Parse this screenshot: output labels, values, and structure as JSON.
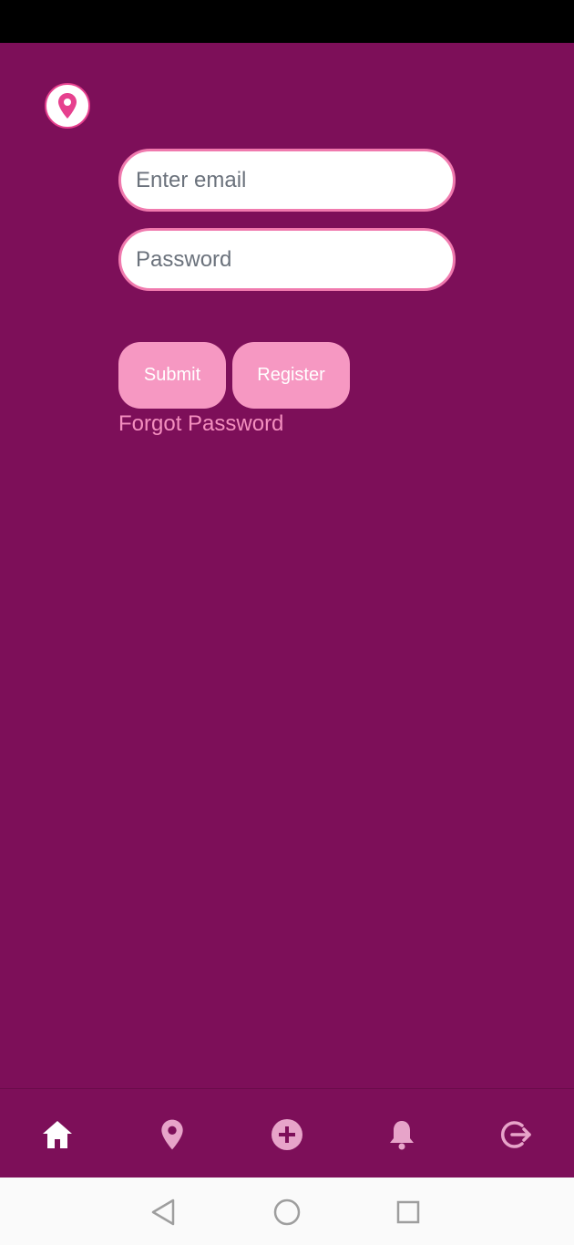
{
  "colors": {
    "background": "#7d0f59",
    "accent": "#f698c2",
    "link": "#f48fbf",
    "field_border": "#f07aae"
  },
  "header": {
    "logo_icon": "location-pin-icon"
  },
  "login": {
    "email_placeholder": "Enter email",
    "password_placeholder": "Password",
    "submit_label": "Submit",
    "register_label": "Register",
    "forgot_label": "Forgot Password"
  },
  "bottom_nav": {
    "items": [
      {
        "icon": "home-icon",
        "active": true
      },
      {
        "icon": "location-pin-icon",
        "active": false
      },
      {
        "icon": "add-circle-icon",
        "active": false
      },
      {
        "icon": "bell-icon",
        "active": false
      },
      {
        "icon": "logout-icon",
        "active": false
      }
    ]
  },
  "system_nav": {
    "items": [
      "back-icon",
      "home-circle-icon",
      "recents-icon"
    ]
  }
}
